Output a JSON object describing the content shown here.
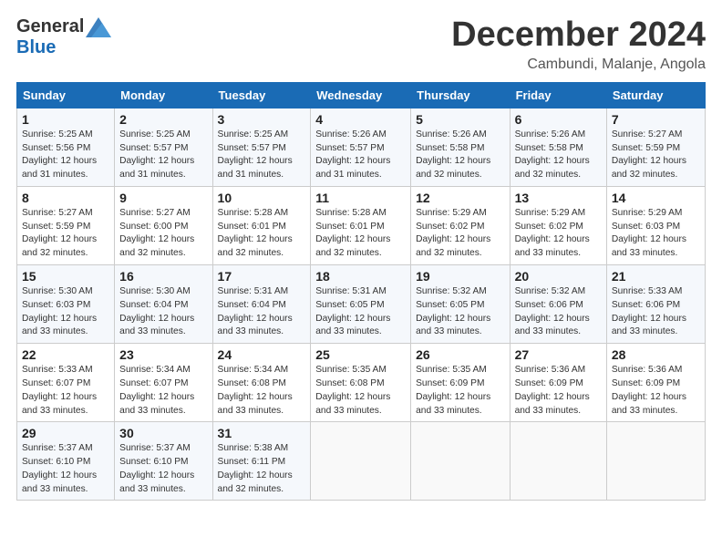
{
  "header": {
    "logo_general": "General",
    "logo_blue": "Blue",
    "month_title": "December 2024",
    "location": "Cambundi, Malanje, Angola"
  },
  "days_of_week": [
    "Sunday",
    "Monday",
    "Tuesday",
    "Wednesday",
    "Thursday",
    "Friday",
    "Saturday"
  ],
  "weeks": [
    [
      {
        "day": "1",
        "info": "Sunrise: 5:25 AM\nSunset: 5:56 PM\nDaylight: 12 hours\nand 31 minutes."
      },
      {
        "day": "2",
        "info": "Sunrise: 5:25 AM\nSunset: 5:57 PM\nDaylight: 12 hours\nand 31 minutes."
      },
      {
        "day": "3",
        "info": "Sunrise: 5:25 AM\nSunset: 5:57 PM\nDaylight: 12 hours\nand 31 minutes."
      },
      {
        "day": "4",
        "info": "Sunrise: 5:26 AM\nSunset: 5:57 PM\nDaylight: 12 hours\nand 31 minutes."
      },
      {
        "day": "5",
        "info": "Sunrise: 5:26 AM\nSunset: 5:58 PM\nDaylight: 12 hours\nand 32 minutes."
      },
      {
        "day": "6",
        "info": "Sunrise: 5:26 AM\nSunset: 5:58 PM\nDaylight: 12 hours\nand 32 minutes."
      },
      {
        "day": "7",
        "info": "Sunrise: 5:27 AM\nSunset: 5:59 PM\nDaylight: 12 hours\nand 32 minutes."
      }
    ],
    [
      {
        "day": "8",
        "info": "Sunrise: 5:27 AM\nSunset: 5:59 PM\nDaylight: 12 hours\nand 32 minutes."
      },
      {
        "day": "9",
        "info": "Sunrise: 5:27 AM\nSunset: 6:00 PM\nDaylight: 12 hours\nand 32 minutes."
      },
      {
        "day": "10",
        "info": "Sunrise: 5:28 AM\nSunset: 6:01 PM\nDaylight: 12 hours\nand 32 minutes."
      },
      {
        "day": "11",
        "info": "Sunrise: 5:28 AM\nSunset: 6:01 PM\nDaylight: 12 hours\nand 32 minutes."
      },
      {
        "day": "12",
        "info": "Sunrise: 5:29 AM\nSunset: 6:02 PM\nDaylight: 12 hours\nand 32 minutes."
      },
      {
        "day": "13",
        "info": "Sunrise: 5:29 AM\nSunset: 6:02 PM\nDaylight: 12 hours\nand 33 minutes."
      },
      {
        "day": "14",
        "info": "Sunrise: 5:29 AM\nSunset: 6:03 PM\nDaylight: 12 hours\nand 33 minutes."
      }
    ],
    [
      {
        "day": "15",
        "info": "Sunrise: 5:30 AM\nSunset: 6:03 PM\nDaylight: 12 hours\nand 33 minutes."
      },
      {
        "day": "16",
        "info": "Sunrise: 5:30 AM\nSunset: 6:04 PM\nDaylight: 12 hours\nand 33 minutes."
      },
      {
        "day": "17",
        "info": "Sunrise: 5:31 AM\nSunset: 6:04 PM\nDaylight: 12 hours\nand 33 minutes."
      },
      {
        "day": "18",
        "info": "Sunrise: 5:31 AM\nSunset: 6:05 PM\nDaylight: 12 hours\nand 33 minutes."
      },
      {
        "day": "19",
        "info": "Sunrise: 5:32 AM\nSunset: 6:05 PM\nDaylight: 12 hours\nand 33 minutes."
      },
      {
        "day": "20",
        "info": "Sunrise: 5:32 AM\nSunset: 6:06 PM\nDaylight: 12 hours\nand 33 minutes."
      },
      {
        "day": "21",
        "info": "Sunrise: 5:33 AM\nSunset: 6:06 PM\nDaylight: 12 hours\nand 33 minutes."
      }
    ],
    [
      {
        "day": "22",
        "info": "Sunrise: 5:33 AM\nSunset: 6:07 PM\nDaylight: 12 hours\nand 33 minutes."
      },
      {
        "day": "23",
        "info": "Sunrise: 5:34 AM\nSunset: 6:07 PM\nDaylight: 12 hours\nand 33 minutes."
      },
      {
        "day": "24",
        "info": "Sunrise: 5:34 AM\nSunset: 6:08 PM\nDaylight: 12 hours\nand 33 minutes."
      },
      {
        "day": "25",
        "info": "Sunrise: 5:35 AM\nSunset: 6:08 PM\nDaylight: 12 hours\nand 33 minutes."
      },
      {
        "day": "26",
        "info": "Sunrise: 5:35 AM\nSunset: 6:09 PM\nDaylight: 12 hours\nand 33 minutes."
      },
      {
        "day": "27",
        "info": "Sunrise: 5:36 AM\nSunset: 6:09 PM\nDaylight: 12 hours\nand 33 minutes."
      },
      {
        "day": "28",
        "info": "Sunrise: 5:36 AM\nSunset: 6:09 PM\nDaylight: 12 hours\nand 33 minutes."
      }
    ],
    [
      {
        "day": "29",
        "info": "Sunrise: 5:37 AM\nSunset: 6:10 PM\nDaylight: 12 hours\nand 33 minutes."
      },
      {
        "day": "30",
        "info": "Sunrise: 5:37 AM\nSunset: 6:10 PM\nDaylight: 12 hours\nand 33 minutes."
      },
      {
        "day": "31",
        "info": "Sunrise: 5:38 AM\nSunset: 6:11 PM\nDaylight: 12 hours\nand 32 minutes."
      },
      {
        "day": "",
        "info": ""
      },
      {
        "day": "",
        "info": ""
      },
      {
        "day": "",
        "info": ""
      },
      {
        "day": "",
        "info": ""
      }
    ]
  ]
}
